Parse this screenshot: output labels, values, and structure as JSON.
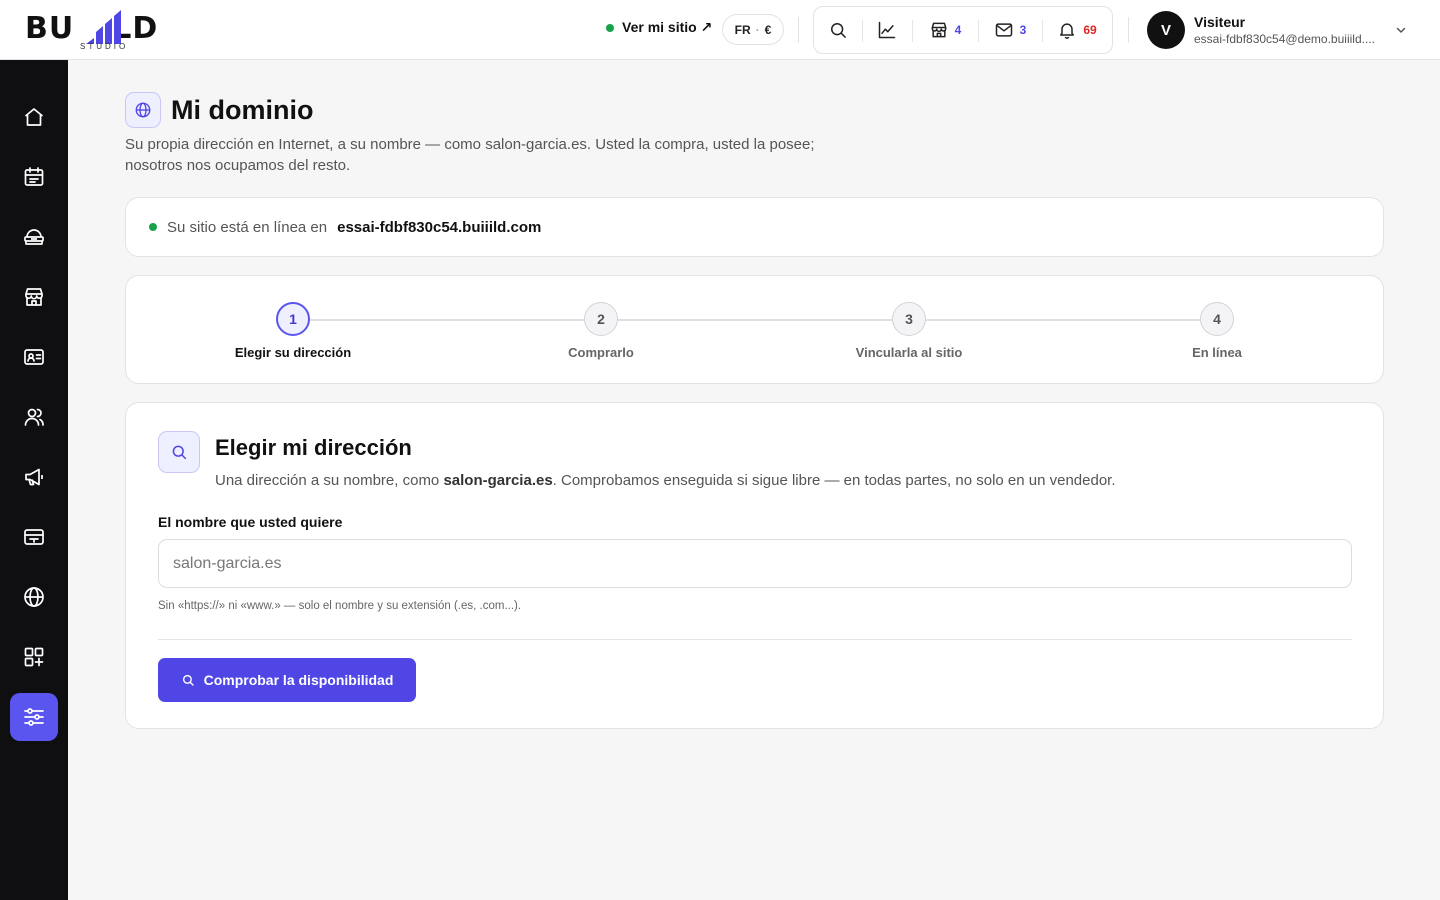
{
  "brand": {
    "name_left": "BU",
    "name_right": "LD",
    "sub": "STUDIO"
  },
  "topbar": {
    "view_site_label": "Ver mi sitio ↗",
    "lang": "FR",
    "lang_separator": "·",
    "currency": "€",
    "tools": [
      {
        "icon": "search-icon",
        "badge": ""
      },
      {
        "icon": "chart-line-icon",
        "badge": ""
      },
      {
        "icon": "store-icon",
        "badge": "4"
      },
      {
        "icon": "mail-icon",
        "badge": "3"
      },
      {
        "icon": "bell-icon",
        "badge": "69"
      }
    ],
    "user": {
      "initial": "V",
      "name": "Visiteur",
      "email": "essai-fdbf830c54@demo.buiiild...."
    }
  },
  "sidebar": {
    "items": [
      {
        "icon": "home-icon",
        "active": false
      },
      {
        "icon": "calendar-icon",
        "active": false
      },
      {
        "icon": "services-icon",
        "active": false
      },
      {
        "icon": "store-icon",
        "active": false
      },
      {
        "icon": "id-card-icon",
        "active": false
      },
      {
        "icon": "users-icon",
        "active": false
      },
      {
        "icon": "megaphone-icon",
        "active": false
      },
      {
        "icon": "payments-icon",
        "active": false
      },
      {
        "icon": "globe-icon",
        "active": false
      },
      {
        "icon": "apps-add-icon",
        "active": false
      },
      {
        "icon": "settings-sliders-icon",
        "active": true
      }
    ]
  },
  "page": {
    "title": "Mi dominio",
    "description": "Su propia dirección en Internet, a su nombre — como salon-garcia.es. Usted la compra, usted la posee; nosotros nos ocupamos del resto."
  },
  "status": {
    "text": "Su sitio está en línea en",
    "domain": "essai-fdbf830c54.buiiild.com",
    "color": "#16a34a"
  },
  "steps": [
    {
      "number": "1",
      "label": "Elegir su dirección",
      "active": true
    },
    {
      "number": "2",
      "label": "Comprarlo",
      "active": false
    },
    {
      "number": "3",
      "label": "Vincularla al sitio",
      "active": false
    },
    {
      "number": "4",
      "label": "En línea",
      "active": false
    }
  ],
  "form": {
    "title": "Elegir mi dirección",
    "desc_before": "Una dirección a su nombre, como",
    "desc_example": "salon-garcia.es",
    "desc_after": ". Comprobamos enseguida si sigue libre — en todas partes, no solo en un vendedor.",
    "field_label": "El nombre que usted quiere",
    "input_value": "",
    "input_placeholder": "salon-garcia.es",
    "hint": "Sin «https://» ni «www.» — solo el nombre y su extensión (.es, .com...).",
    "button_label": "Comprobar la disponibilidad"
  },
  "colors": {
    "accent": "#4f46e5",
    "sidebar_active": "#5b55ef",
    "badge_blue": "#4f46e5",
    "badge_red": "#dc2626",
    "online_green": "#16a34a"
  }
}
